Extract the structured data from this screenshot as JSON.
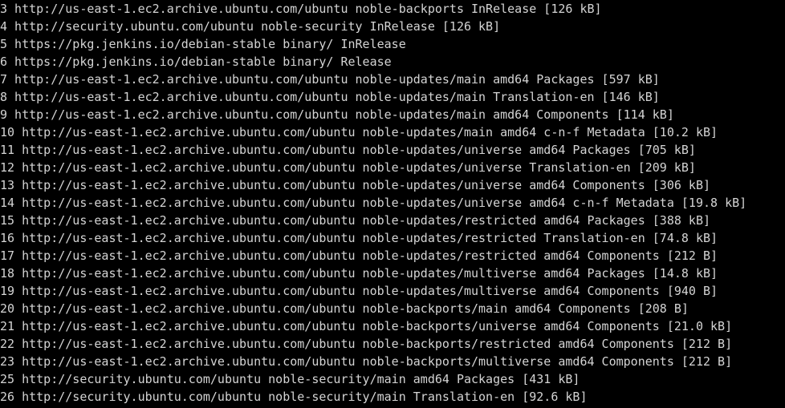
{
  "terminal": {
    "lines": [
      "3 http://us-east-1.ec2.archive.ubuntu.com/ubuntu noble-backports InRelease [126 kB]",
      "4 http://security.ubuntu.com/ubuntu noble-security InRelease [126 kB]",
      "5 https://pkg.jenkins.io/debian-stable binary/ InRelease",
      "6 https://pkg.jenkins.io/debian-stable binary/ Release",
      "7 http://us-east-1.ec2.archive.ubuntu.com/ubuntu noble-updates/main amd64 Packages [597 kB]",
      "8 http://us-east-1.ec2.archive.ubuntu.com/ubuntu noble-updates/main Translation-en [146 kB]",
      "9 http://us-east-1.ec2.archive.ubuntu.com/ubuntu noble-updates/main amd64 Components [114 kB]",
      "10 http://us-east-1.ec2.archive.ubuntu.com/ubuntu noble-updates/main amd64 c-n-f Metadata [10.2 kB]",
      "11 http://us-east-1.ec2.archive.ubuntu.com/ubuntu noble-updates/universe amd64 Packages [705 kB]",
      "12 http://us-east-1.ec2.archive.ubuntu.com/ubuntu noble-updates/universe Translation-en [209 kB]",
      "13 http://us-east-1.ec2.archive.ubuntu.com/ubuntu noble-updates/universe amd64 Components [306 kB]",
      "14 http://us-east-1.ec2.archive.ubuntu.com/ubuntu noble-updates/universe amd64 c-n-f Metadata [19.8 kB]",
      "15 http://us-east-1.ec2.archive.ubuntu.com/ubuntu noble-updates/restricted amd64 Packages [388 kB]",
      "16 http://us-east-1.ec2.archive.ubuntu.com/ubuntu noble-updates/restricted Translation-en [74.8 kB]",
      "17 http://us-east-1.ec2.archive.ubuntu.com/ubuntu noble-updates/restricted amd64 Components [212 B]",
      "18 http://us-east-1.ec2.archive.ubuntu.com/ubuntu noble-updates/multiverse amd64 Packages [14.8 kB]",
      "19 http://us-east-1.ec2.archive.ubuntu.com/ubuntu noble-updates/multiverse amd64 Components [940 B]",
      "20 http://us-east-1.ec2.archive.ubuntu.com/ubuntu noble-backports/main amd64 Components [208 B]",
      "21 http://us-east-1.ec2.archive.ubuntu.com/ubuntu noble-backports/universe amd64 Components [21.0 kB]",
      "22 http://us-east-1.ec2.archive.ubuntu.com/ubuntu noble-backports/restricted amd64 Components [212 B]",
      "23 http://us-east-1.ec2.archive.ubuntu.com/ubuntu noble-backports/multiverse amd64 Components [212 B]",
      "25 http://security.ubuntu.com/ubuntu noble-security/main amd64 Packages [431 kB]",
      "26 http://security.ubuntu.com/ubuntu noble-security/main Translation-en [92.6 kB]"
    ]
  },
  "colors": {
    "background": "#000000",
    "foreground": "#d4d4d4"
  }
}
